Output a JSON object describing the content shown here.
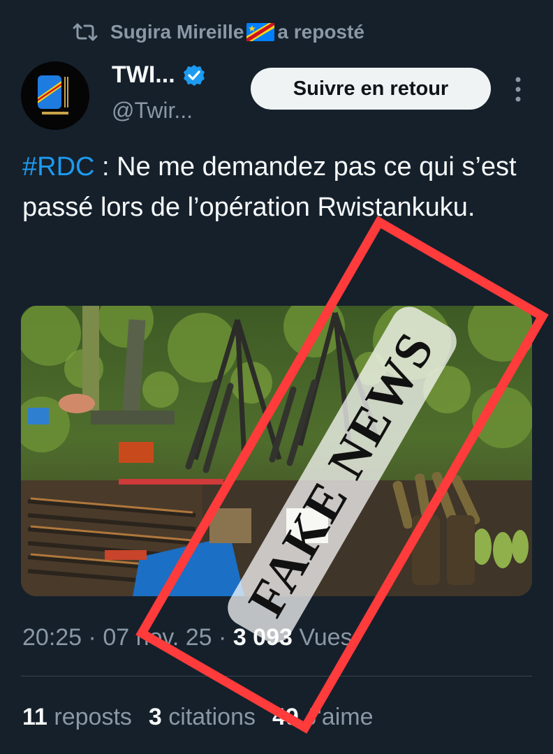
{
  "repost": {
    "user": "Sugira Mireille",
    "suffix": " a reposté",
    "icon": "repost-icon",
    "flag": "drc-flag-emoji"
  },
  "author": {
    "name": "TWI...",
    "handle": "@Twir...",
    "verified": true,
    "avatar_icon": "raised-fist-drc-flag-icon"
  },
  "follow_button": "Suivre en retour",
  "more_icon": "more-vertical-icon",
  "tweet": {
    "hashtag": "#RDC",
    "text": " : Ne me demandez pas ce qui s’est passé lors de l’opération Rwistankuku."
  },
  "media": {
    "description_icon": "seized-weapons-photo"
  },
  "watermark": {
    "text": "FAKE NEWS",
    "color": "#ff3b3b"
  },
  "meta": {
    "time": "20:25",
    "sep1": " · ",
    "date": "07 nov. 25",
    "sep2": " · ",
    "views": "3 093",
    "views_label": " Vues"
  },
  "stats": {
    "reposts_count": "11",
    "reposts_label": " reposts",
    "citations_count": "3",
    "citations_label": " citations",
    "likes_count": "49",
    "likes_label": " J'aime"
  },
  "colors": {
    "background": "#15202b",
    "text": "#f7f9f9",
    "muted": "#8b98a5",
    "link": "#1d9bf0",
    "verified": "#1d9bf0"
  }
}
